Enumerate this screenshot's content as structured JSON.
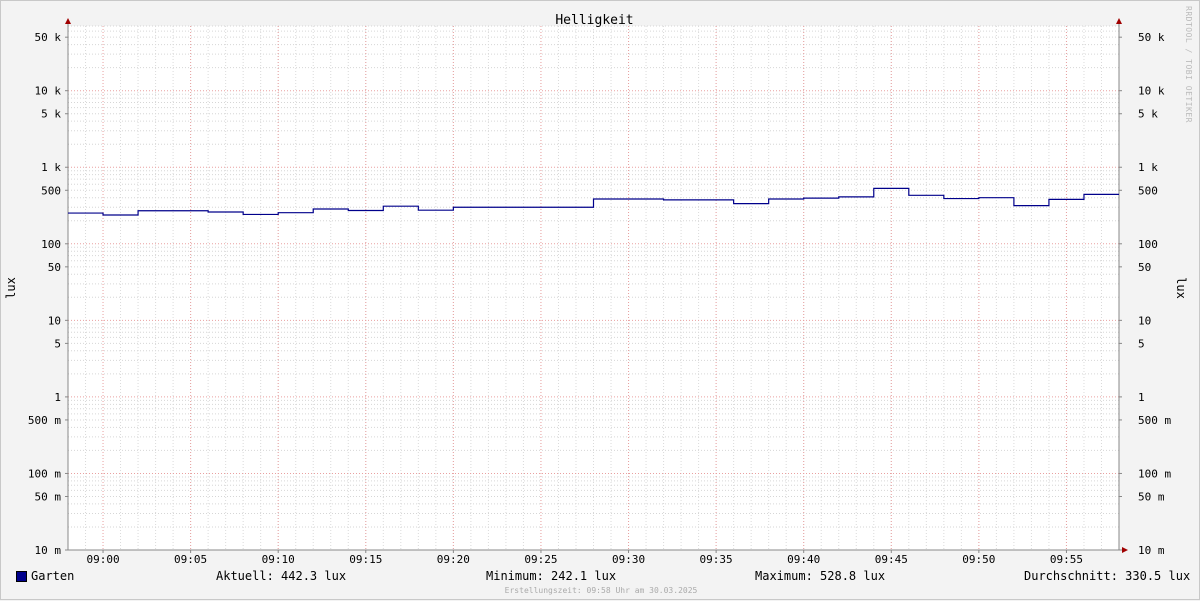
{
  "chart_data": {
    "type": "line",
    "title": "Helligkeit",
    "ylabel": "lux",
    "yscale": "log",
    "ylim": [
      0.01,
      70000
    ],
    "xlim": [
      "08:58",
      "09:58"
    ],
    "grid": true,
    "y_ticks": [
      {
        "v": 50000,
        "label": "50 k"
      },
      {
        "v": 10000,
        "label": "10 k"
      },
      {
        "v": 5000,
        "label": "5 k"
      },
      {
        "v": 1000,
        "label": "1 k"
      },
      {
        "v": 500,
        "label": "500"
      },
      {
        "v": 100,
        "label": "100"
      },
      {
        "v": 50,
        "label": "50"
      },
      {
        "v": 10,
        "label": "10"
      },
      {
        "v": 5,
        "label": "5"
      },
      {
        "v": 1,
        "label": "1"
      },
      {
        "v": 0.5,
        "label": "500 m"
      },
      {
        "v": 0.1,
        "label": "100 m"
      },
      {
        "v": 0.05,
        "label": "50 m"
      },
      {
        "v": 0.01,
        "label": "10 m"
      }
    ],
    "x_ticks": [
      "09:00",
      "09:05",
      "09:10",
      "09:15",
      "09:20",
      "09:25",
      "09:30",
      "09:35",
      "09:40",
      "09:45",
      "09:50",
      "09:55"
    ],
    "series": [
      {
        "name": "Garten",
        "color": "#00008b",
        "x": [
          "08:58",
          "09:00",
          "09:02",
          "09:06",
          "09:08",
          "09:10",
          "09:12",
          "09:14",
          "09:16",
          "09:18",
          "09:20",
          "09:22",
          "09:24",
          "09:26",
          "09:28",
          "09:30",
          "09:32",
          "09:34",
          "09:36",
          "09:38",
          "09:40",
          "09:42",
          "09:44",
          "09:46",
          "09:48",
          "09:50",
          "09:52",
          "09:54",
          "09:56"
        ],
        "values": [
          252,
          238,
          270,
          260,
          242,
          255,
          285,
          272,
          310,
          275,
          300,
          300,
          300,
          300,
          385,
          385,
          375,
          375,
          335,
          385,
          395,
          410,
          530,
          430,
          390,
          400,
          315,
          380,
          442.3
        ]
      }
    ]
  },
  "legend": {
    "series_name": "Garten",
    "aktuell": "Aktuell: 442.3 lux",
    "minimum": "Minimum: 242.1 lux",
    "maximum": "Maximum: 528.8 lux",
    "durchschnitt": "Durchschnitt: 330.5 lux"
  },
  "footer": "Erstellungszeit: 09:58 Uhr am 30.03.2025",
  "vendor_text": "RRDTOOL / TOBI OETIKER"
}
